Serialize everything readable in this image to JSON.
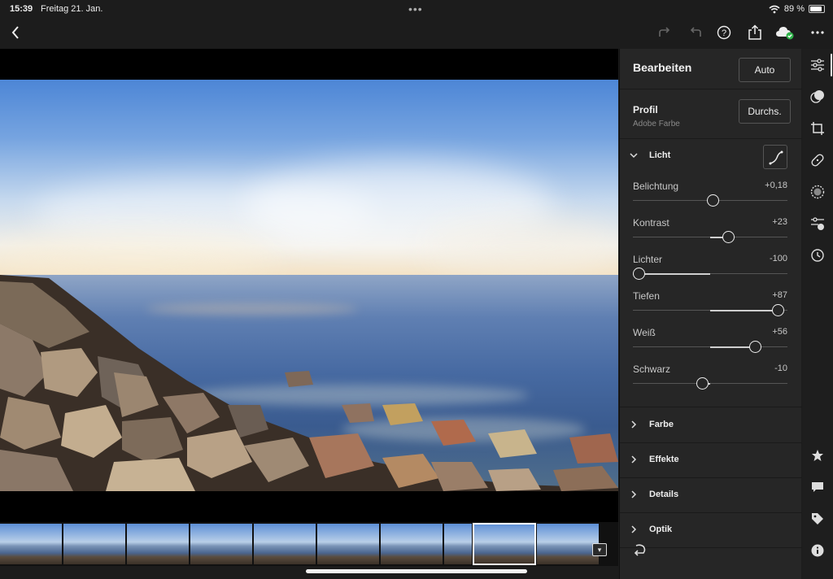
{
  "status_bar": {
    "time": "15:39",
    "date": "Freitag 21. Jan.",
    "battery": "89 %",
    "battery_level": 0.89
  },
  "toolbar": {
    "back_icon": "chevron-left-icon",
    "redo_icon": "redo-icon",
    "undo_icon": "undo-icon",
    "help_icon": "help-icon",
    "share_icon": "share-icon",
    "cloud_icon": "cloud-synced-icon",
    "more_icon": "more-icon"
  },
  "panel": {
    "title": "Bearbeiten",
    "auto_label": "Auto",
    "profile": {
      "label": "Profil",
      "value": "Adobe Farbe",
      "button": "Durchs."
    },
    "light": {
      "name": "Licht",
      "sliders": [
        {
          "name": "Belichtung",
          "value": "+0,18",
          "position": 0.52
        },
        {
          "name": "Kontrast",
          "value": "+23",
          "position": 0.62
        },
        {
          "name": "Lichter",
          "value": "-100",
          "position": 0.0
        },
        {
          "name": "Tiefen",
          "value": "+87",
          "position": 0.94
        },
        {
          "name": "Weiß",
          "value": "+56",
          "position": 0.79
        },
        {
          "name": "Schwarz",
          "value": "-10",
          "position": 0.45
        }
      ]
    },
    "sections": [
      "Farbe",
      "Effekte",
      "Details",
      "Optik"
    ]
  },
  "sidebar": {
    "icons": [
      "edit-sliders-icon",
      "masking-icon",
      "crop-icon",
      "healing-icon",
      "selective-icon",
      "presets-icon",
      "history-icon",
      "star-icon",
      "comment-icon",
      "tag-icon",
      "info-icon"
    ]
  },
  "filmstrip": {
    "count": 10,
    "selected_index": 7
  },
  "colors": {
    "accent": "#ffffff",
    "panel_bg": "#262626",
    "cloud_ok": "#2fb34a"
  }
}
